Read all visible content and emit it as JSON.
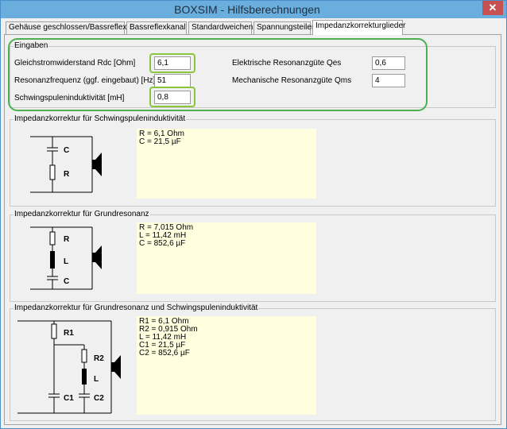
{
  "window": {
    "title": "BOXSIM - Hilfsberechnungen",
    "close_glyph": "✕"
  },
  "tabs": [
    {
      "label": "Gehäuse geschlossen/Bassreflex"
    },
    {
      "label": "Bassreflexkanal"
    },
    {
      "label": "Standardweichen"
    },
    {
      "label": "Spannungsteiler"
    },
    {
      "label": "Impedanzkorrekturglieder",
      "active": true
    }
  ],
  "inputs": {
    "group_label": "Eingaben",
    "rdc": {
      "label": "Gleichstromwiderstand Rdc [Ohm]",
      "value": "6,1"
    },
    "fs": {
      "label": "Resonanzfrequenz (ggf. eingebaut) [Hz]",
      "value": "51"
    },
    "le": {
      "label": "Schwingspuleninduktivität [mH]",
      "value": "0,8"
    },
    "qes": {
      "label": "Elektrische Resonanzgüte Qes",
      "value": "0,6"
    },
    "qms": {
      "label": "Mechanische Resonanzgüte Qms",
      "value": "4"
    }
  },
  "section1": {
    "title": "Impedanzkorrektur für Schwingspuleninduktivität",
    "labels": {
      "c": "C",
      "r": "R"
    },
    "results": [
      "R = 6,1 Ohm",
      "C = 21,5 µF"
    ]
  },
  "section2": {
    "title": "Impedanzkorrektur für Grundresonanz",
    "labels": {
      "r": "R",
      "l": "L",
      "c": "C"
    },
    "results": [
      "R = 7,015 Ohm",
      "L = 11,42 mH",
      "C = 852,6 µF"
    ]
  },
  "section3": {
    "title": "Impedanzkorrektur für Grundresonanz und Schwingspuleninduktivität",
    "labels": {
      "r1": "R1",
      "r2": "R2",
      "l": "L",
      "c1": "C1",
      "c2": "C2"
    },
    "results": [
      "R1 = 6,1 Ohm",
      "R2 = 0,915 Ohm",
      "L  = 11,42 mH",
      "C1 = 21,5 µF",
      "C2 = 852,6 µF"
    ]
  },
  "colors": {
    "highlight_input": "#8cc63f",
    "highlight_group": "#4caf50",
    "result_bg": "#ffffe0",
    "titlebar": "#6aaede"
  }
}
